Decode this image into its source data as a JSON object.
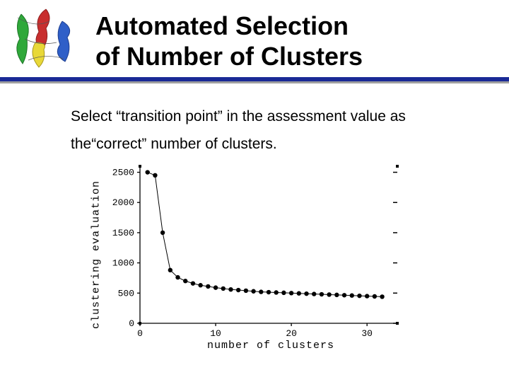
{
  "title_line1": "Automated Selection",
  "title_line2": "of Number of Clusters",
  "body": "Select “transition point” in the assessment value as the“correct” number of clusters.",
  "chart_data": {
    "type": "scatter",
    "title": "",
    "xlabel": "number of clusters",
    "ylabel": "clustering evaluation",
    "xlim": [
      0,
      34
    ],
    "ylim": [
      0,
      2600
    ],
    "xticks": [
      0,
      10,
      20,
      30
    ],
    "yticks": [
      0,
      500,
      1000,
      1500,
      2000,
      2500
    ],
    "series": [
      {
        "name": "evaluation",
        "x": [
          1,
          2,
          3,
          4,
          5,
          6,
          7,
          8,
          9,
          10,
          11,
          12,
          13,
          14,
          15,
          16,
          17,
          18,
          19,
          20,
          21,
          22,
          23,
          24,
          25,
          26,
          27,
          28,
          29,
          30,
          31,
          32
        ],
        "y": [
          2500,
          2450,
          1500,
          880,
          760,
          700,
          660,
          630,
          610,
          590,
          575,
          560,
          550,
          540,
          530,
          520,
          515,
          510,
          505,
          500,
          495,
          490,
          485,
          480,
          475,
          470,
          465,
          460,
          455,
          450,
          445,
          440
        ]
      }
    ]
  }
}
